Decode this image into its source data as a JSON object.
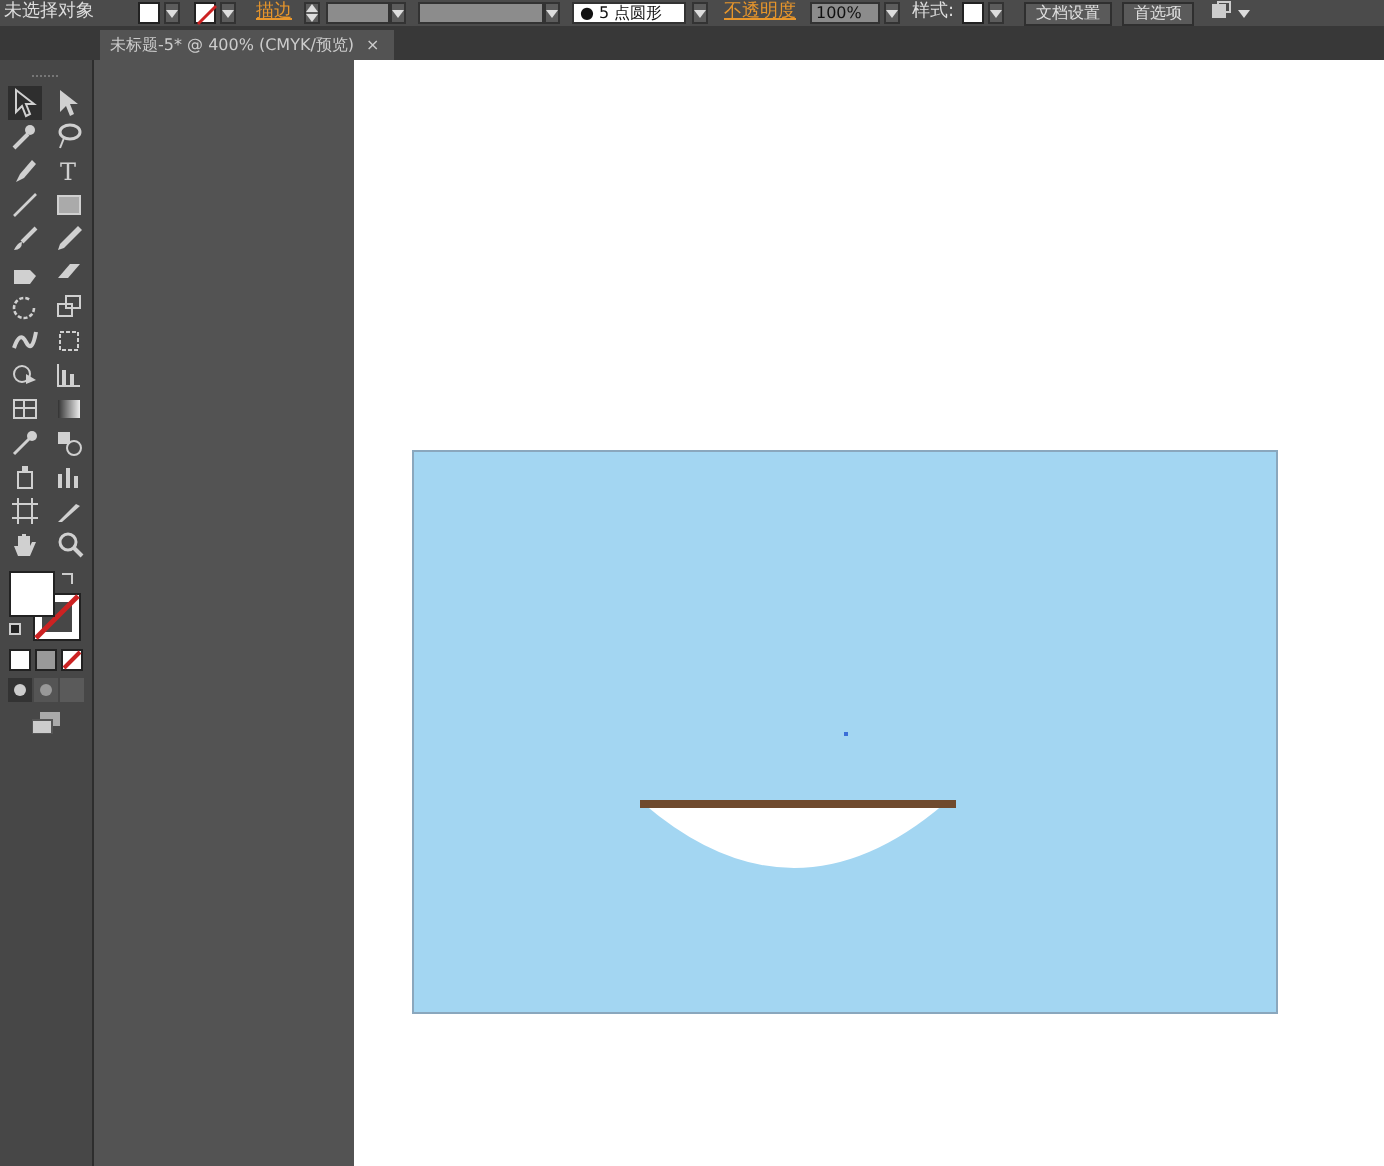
{
  "control_bar": {
    "selection_label": "未选择对象",
    "stroke_label": "描边",
    "brush": {
      "dot": "●",
      "value": "5 点圆形"
    },
    "opacity_label": "不透明度",
    "opacity_value": "100%",
    "style_label": "样式:",
    "buttons": [
      "文档设置",
      "首选项"
    ]
  },
  "document_tab": {
    "title": "未标题-5* @ 400% (CMYK/预览)",
    "close": "×",
    "selected": true
  },
  "tools": [
    {
      "kind": "selection",
      "selected": true
    },
    {
      "kind": "direct-selection",
      "selected": false
    },
    {
      "kind": "magic-wand",
      "selected": false
    },
    {
      "kind": "lasso",
      "selected": false
    },
    {
      "kind": "pen",
      "selected": false
    },
    {
      "kind": "type",
      "glyph": "T",
      "selected": false
    },
    {
      "kind": "line",
      "selected": false
    },
    {
      "kind": "rectangle",
      "selected": false
    },
    {
      "kind": "brush",
      "selected": false
    },
    {
      "kind": "pencil",
      "selected": false
    },
    {
      "kind": "blob",
      "selected": false
    },
    {
      "kind": "eraser",
      "selected": false
    },
    {
      "kind": "rotate",
      "selected": false
    },
    {
      "kind": "scale",
      "selected": false
    },
    {
      "kind": "warp",
      "selected": false
    },
    {
      "kind": "free-transform",
      "selected": false
    },
    {
      "kind": "shape-builder",
      "selected": false
    },
    {
      "kind": "graph",
      "selected": false
    },
    {
      "kind": "mesh",
      "selected": false
    },
    {
      "kind": "gradient",
      "selected": false
    },
    {
      "kind": "eyedropper",
      "selected": false
    },
    {
      "kind": "blend",
      "selected": false
    },
    {
      "kind": "symbol",
      "selected": false
    },
    {
      "kind": "column-graph",
      "selected": false
    },
    {
      "kind": "artboard",
      "selected": false
    },
    {
      "kind": "slice",
      "selected": false
    },
    {
      "kind": "hand",
      "selected": false
    },
    {
      "kind": "zoom",
      "selected": false
    }
  ]
}
